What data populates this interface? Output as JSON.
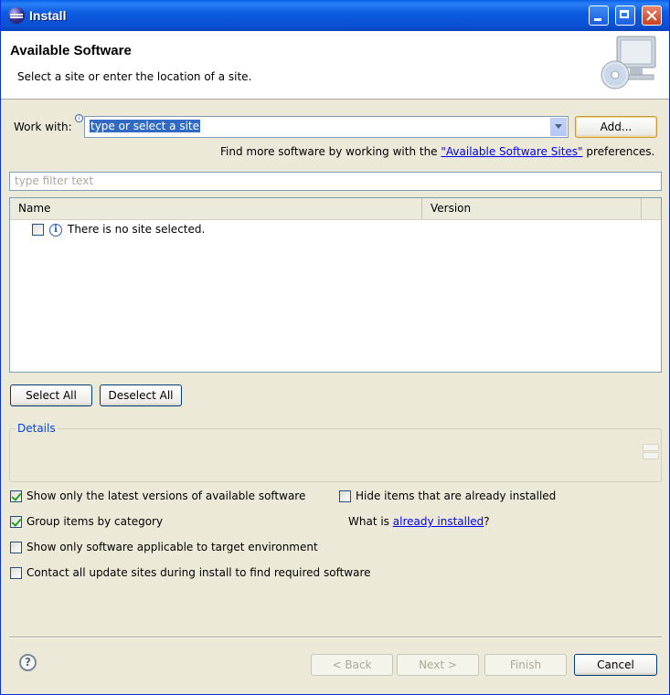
{
  "window": {
    "title": "Install"
  },
  "header": {
    "title": "Available Software",
    "subtitle": "Select a site or enter the location of a site."
  },
  "work_with": {
    "label": "Work with:",
    "value": "type or select a site",
    "add_button": "Add...",
    "hint_prefix": "Find more software by working with the ",
    "hint_link": "\"Available Software Sites\"",
    "hint_suffix": " preferences."
  },
  "filter": {
    "placeholder": "type filter text"
  },
  "tree": {
    "columns": [
      "Name",
      "Version"
    ],
    "rows": [
      {
        "label": "There is no site selected.",
        "checked": false
      }
    ]
  },
  "selection_buttons": {
    "select_all": "Select All",
    "deselect_all": "Deselect All"
  },
  "details": {
    "label": "Details"
  },
  "options": {
    "show_latest": {
      "label": "Show only the latest versions of available software",
      "checked": true
    },
    "hide_installed": {
      "label": "Hide items that are already installed",
      "checked": false
    },
    "group_by_category": {
      "label": "Group items by category",
      "checked": true
    },
    "what_is_prefix": "What is ",
    "what_is_link": "already installed",
    "what_is_suffix": "?",
    "applicable_only": {
      "label": "Show only software applicable to target environment",
      "checked": false
    },
    "contact_all_sites": {
      "label": "Contact all update sites during install to find required software",
      "checked": false
    }
  },
  "footer": {
    "back": "< Back",
    "next": "Next >",
    "finish": "Finish",
    "cancel": "Cancel"
  }
}
